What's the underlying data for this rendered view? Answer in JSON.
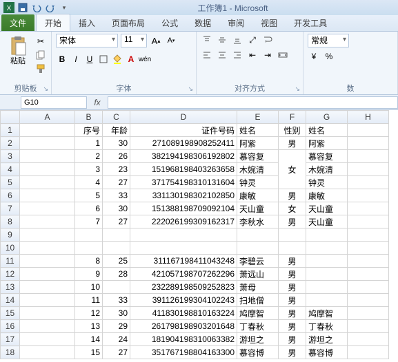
{
  "window": {
    "title": "工作簿1 - Microsoft"
  },
  "qat": {
    "save": "save-icon",
    "undo": "undo-icon",
    "redo": "redo-icon"
  },
  "tabs": {
    "file": "文件",
    "items": [
      "开始",
      "插入",
      "页面布局",
      "公式",
      "数据",
      "审阅",
      "视图",
      "开发工具"
    ],
    "active": 0
  },
  "ribbon": {
    "clipboard": {
      "paste": "粘贴",
      "label": "剪贴板"
    },
    "font": {
      "name": "宋体",
      "size": "11",
      "label": "字体",
      "bold": "B",
      "italic": "I",
      "underline": "U"
    },
    "align": {
      "label": "对齐方式"
    },
    "number": {
      "label": "数",
      "format": "常规"
    }
  },
  "namebox": {
    "ref": "G10",
    "fx": "fx",
    "formula": ""
  },
  "columns": [
    "A",
    "B",
    "C",
    "D",
    "E",
    "F",
    "G",
    "H"
  ],
  "headers": {
    "B": "序号",
    "C": "年龄",
    "D": "证件号码",
    "E": "姓名",
    "F": "性别",
    "G": "姓名"
  },
  "rows": [
    {
      "n": 1
    },
    {
      "n": 2,
      "B": "1",
      "C": "30",
      "D": "271089198908252411",
      "E": "阿紫",
      "F": "男",
      "G": "阿紫"
    },
    {
      "n": 3,
      "B": "2",
      "C": "26",
      "D": "382194198306192802",
      "E": "慕容复",
      "F": "女",
      "Fmerge": true,
      "G": "慕容复"
    },
    {
      "n": 4,
      "B": "3",
      "C": "23",
      "D": "151968198403263658",
      "E": "木婉清",
      "G": "木婉清"
    },
    {
      "n": 5,
      "B": "4",
      "C": "27",
      "D": "371754198310131604",
      "E": "钟灵",
      "G": "钟灵"
    },
    {
      "n": 6,
      "B": "5",
      "C": "33",
      "D": "331130198302102850",
      "E": "康敏",
      "F": "男",
      "G": "康敏"
    },
    {
      "n": 7,
      "B": "6",
      "C": "30",
      "D": "151388198709092104",
      "E": "天山童",
      "F": "女",
      "G": "天山童"
    },
    {
      "n": 8,
      "B": "7",
      "C": "27",
      "D": "222026199309162317",
      "E": "李秋水",
      "F": "男",
      "G": "天山童"
    },
    {
      "n": 9
    },
    {
      "n": 10
    },
    {
      "n": 11,
      "B": "8",
      "C": "25",
      "D": "311167198411043248",
      "E": "李碧云",
      "F": "男"
    },
    {
      "n": 12,
      "B": "9",
      "C": "28",
      "D": "421057198707262296",
      "E": "萧远山",
      "F": "男"
    },
    {
      "n": 13,
      "B": "10",
      "C": "",
      "D": "232289198509252823",
      "E": "萧母",
      "F": "男"
    },
    {
      "n": 14,
      "B": "11",
      "C": "33",
      "D": "391126199304102243",
      "E": "扫地僧",
      "F": "男"
    },
    {
      "n": 15,
      "B": "12",
      "C": "30",
      "D": "411830198810163224",
      "E": "鸠摩智",
      "F": "男",
      "G": "鸠摩智"
    },
    {
      "n": 16,
      "B": "13",
      "C": "29",
      "D": "261798198903201648",
      "E": "丁春秋",
      "F": "男",
      "G": "丁春秋"
    },
    {
      "n": 17,
      "B": "14",
      "C": "24",
      "D": "181904198310063382",
      "E": "游坦之",
      "F": "男",
      "G": "游坦之"
    },
    {
      "n": 18,
      "B": "15",
      "C": "27",
      "D": "351767198804163300",
      "E": "慕容博",
      "F": "男",
      "G": "慕容博"
    }
  ]
}
